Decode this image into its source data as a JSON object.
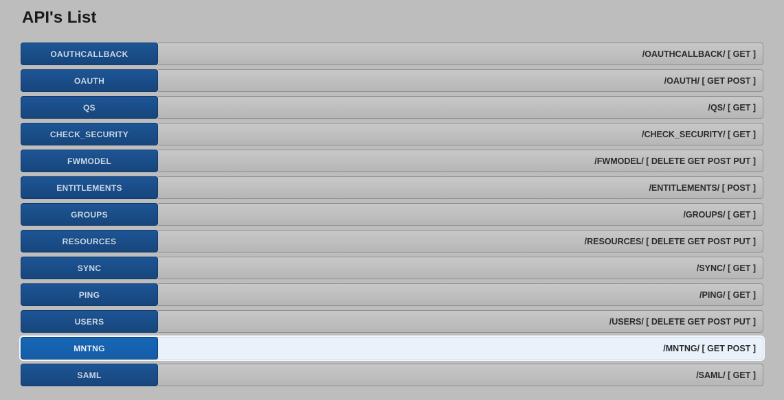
{
  "title": "API's List",
  "selected_index": 11,
  "apis": [
    {
      "name": "OAUTHCALLBACK",
      "path": "/OAUTHCALLBACK/ [ GET ]"
    },
    {
      "name": "OAUTH",
      "path": "/OAUTH/ [ GET POST ]"
    },
    {
      "name": "QS",
      "path": "/QS/ [ GET ]"
    },
    {
      "name": "CHECK_SECURITY",
      "path": "/CHECK_SECURITY/ [ GET ]"
    },
    {
      "name": "FWMODEL",
      "path": "/FWMODEL/ [ DELETE GET POST PUT ]"
    },
    {
      "name": "ENTITLEMENTS",
      "path": "/ENTITLEMENTS/ [ POST ]"
    },
    {
      "name": "GROUPS",
      "path": "/GROUPS/ [ GET ]"
    },
    {
      "name": "RESOURCES",
      "path": "/RESOURCES/ [ DELETE GET POST PUT ]"
    },
    {
      "name": "SYNC",
      "path": "/SYNC/ [ GET ]"
    },
    {
      "name": "PING",
      "path": "/PING/ [ GET ]"
    },
    {
      "name": "USERS",
      "path": "/USERS/ [ DELETE GET POST PUT ]"
    },
    {
      "name": "MNTNG",
      "path": "/MNTNG/ [ GET POST ]"
    },
    {
      "name": "SAML",
      "path": "/SAML/ [ GET ]"
    }
  ]
}
